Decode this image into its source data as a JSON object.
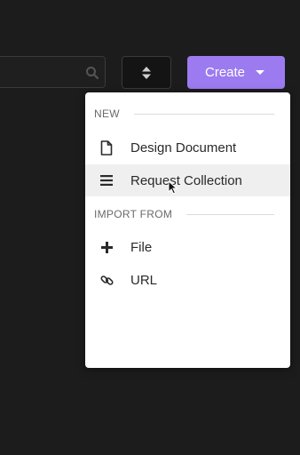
{
  "toolbar": {
    "search": {
      "value": "",
      "placeholder": "",
      "icon": "search-icon"
    },
    "sort": {
      "icon": "sort-icon"
    },
    "create": {
      "label": "Create",
      "icon": "caret-down-icon",
      "color": "#9c7bf0"
    }
  },
  "dropdown": {
    "sections": [
      {
        "header": "NEW",
        "items": [
          {
            "label": "Design Document",
            "icon": "document-icon"
          },
          {
            "label": "Request Collection",
            "icon": "list-icon",
            "hovered": true
          }
        ]
      },
      {
        "header": "IMPORT FROM",
        "items": [
          {
            "label": "File",
            "icon": "plus-icon"
          },
          {
            "label": "URL",
            "icon": "link-icon"
          }
        ]
      }
    ]
  },
  "colors": {
    "background": "#1d1c1d",
    "menu_background": "#ffffff",
    "hover_background": "#efefef",
    "accent": "#9c7bf0"
  }
}
